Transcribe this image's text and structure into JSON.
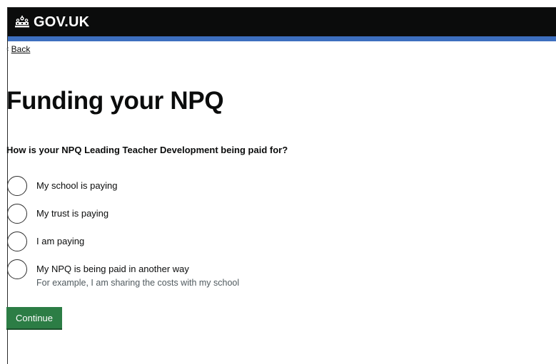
{
  "header": {
    "logo_text": "GOV.UK",
    "crown_icon": "crown-icon",
    "bar_color": "#0b0c0c",
    "accent_color": "#3d6fbf"
  },
  "back_link": {
    "chevron": "‹",
    "label": "Back"
  },
  "page_title": "Funding your NPQ",
  "question": "How is your NPQ Leading Teacher Development being paid for?",
  "options": [
    {
      "label": "My school is paying",
      "selected": false
    },
    {
      "label": "My trust is paying",
      "selected": false
    },
    {
      "label": "I am paying",
      "selected": false
    },
    {
      "label": "My NPQ is being paid in another way",
      "hint": "For example, I am sharing the costs with my school",
      "selected": false
    }
  ],
  "continue_button": {
    "label": "Continue",
    "color": "#2c7d45"
  }
}
